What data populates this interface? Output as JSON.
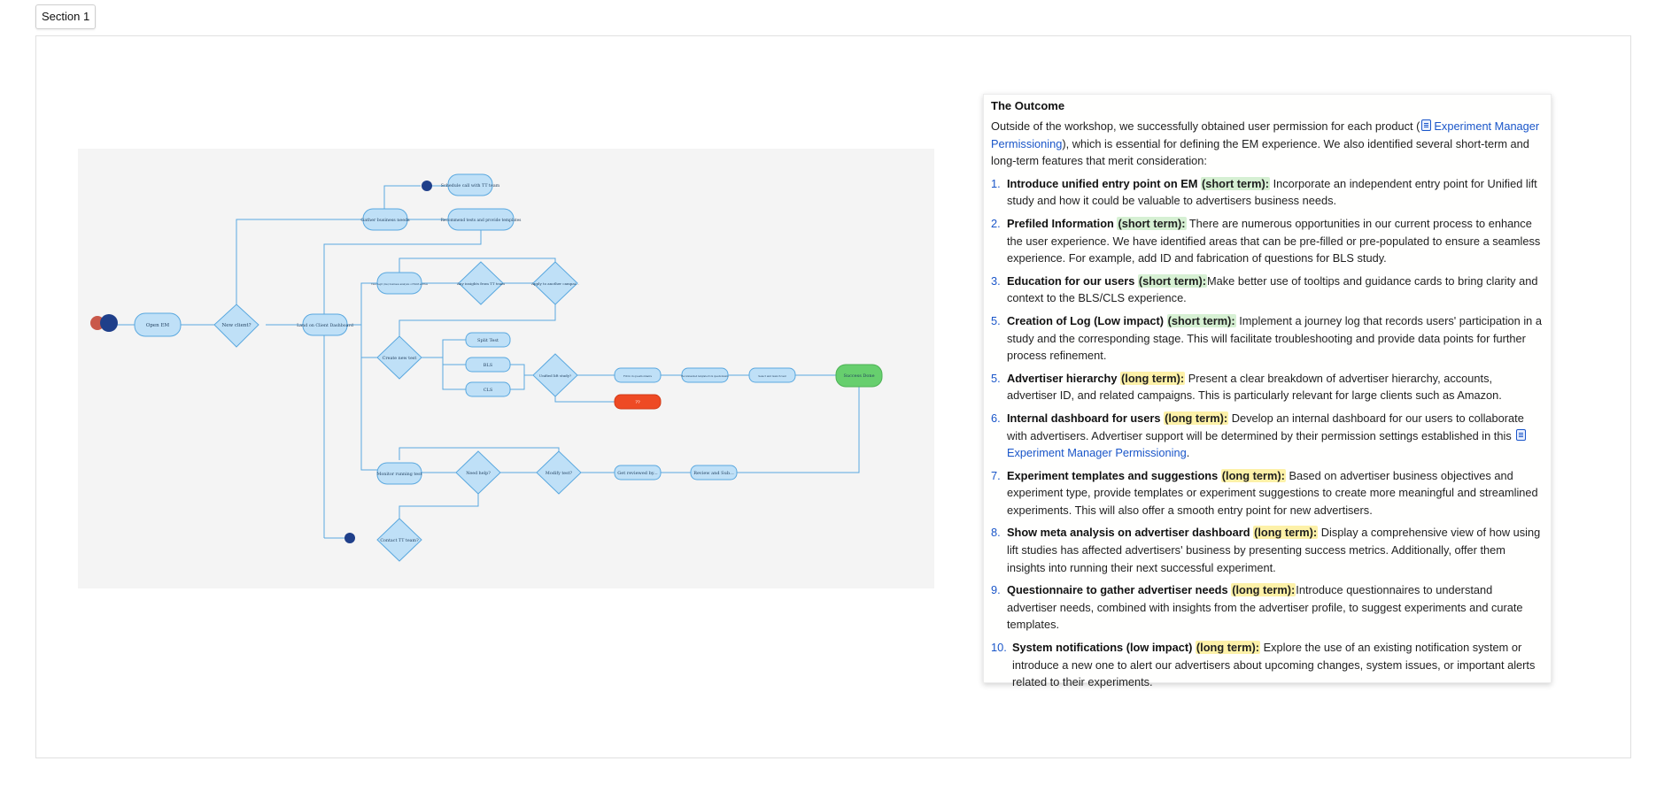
{
  "section": {
    "label": "Section 1"
  },
  "flow": {
    "nodes": {
      "open_em": "Open EM",
      "new_client": "New client?",
      "land_dashboard": "Land on Client Dashboard",
      "gather_needs": "Gather business needs",
      "schedule_call": "Schedule call with TT team",
      "recommend_tests": "Recommend tests and provide templates",
      "view_legit": "View legit (ms) business analysis of RAM entries",
      "any_insights": "Any insights from TT team",
      "apply_another": "Apply to another campai...",
      "create_test": "Create new test",
      "split_test": "Split Test",
      "bls": "BLS",
      "cls": "CLS",
      "unified_lift": "Unified lift study?",
      "fill_questionnaire": "Fill in in questionnaire",
      "recommend_template": "Recommended template from questionnaire",
      "select_campaign": "Select and launch test",
      "unknown": "??",
      "success": "Success Done",
      "monitor": "Monitor running test",
      "need_help": "Need help?",
      "modify_test": "Modify test?",
      "get_reviewed": "Get reviewed by...",
      "review_submit": "Review and Sub...",
      "contact_team": "Contact TT team?"
    }
  },
  "outcome": {
    "title": "The Outcome",
    "intro_before": "Outside of the workshop, we successfully obtained user permission for each product (",
    "intro_link": "Experiment Manager Permissioning",
    "intro_after": "), which is essential for defining the EM experience. We also identified several short-term and long-term features that merit consideration:",
    "items": [
      {
        "num": "1.",
        "title": "Introduce unified entry point on EM",
        "tag": "(short term):",
        "text": "Incorporate an independent entry point for Unified lift study and how it could be valuable to advertisers business needs."
      },
      {
        "num": "2.",
        "title": "Prefiled Information",
        "tag": "(short term):",
        "text": "There are numerous opportunities in our current process to enhance the user experience. We have identified areas that can be pre-filled or pre-populated to ensure a seamless experience. For example, add ID and fabrication of questions for BLS study."
      },
      {
        "num": "3.",
        "title": "Education for our users",
        "tag": "(short term):",
        "text": "Make better use of tooltips and guidance cards to bring clarity and context to the BLS/CLS experience."
      },
      {
        "num": "5.",
        "title": "Creation of Log (Low impact)",
        "tag": "(short term):",
        "text": "Implement a journey log that records users' participation in a study and the corresponding stage. This will facilitate troubleshooting and provide data points for further process refinement."
      },
      {
        "num": "5.",
        "title": "Advertiser hierarchy",
        "tag": "(long term):",
        "text": "Present a clear breakdown of advertiser hierarchy, accounts, advertiser ID, and related campaigns. This is particularly relevant for large clients such as Amazon."
      },
      {
        "num": "6.",
        "title": "Internal dashboard for users",
        "tag": "(long term):",
        "text": "Develop an internal dashboard for our users to collaborate with advertisers. Advertiser support will be determined by their permission settings established in this",
        "link": "Experiment Manager Permissioning",
        "after": "."
      },
      {
        "num": "7.",
        "title": "Experiment templates and suggestions",
        "tag": "(long term):",
        "text": "Based on advertiser business objectives and experiment type, provide templates or experiment suggestions to create more meaningful and streamlined experiments. This will also offer a smooth entry point for new advertisers."
      },
      {
        "num": "8.",
        "title": "Show meta analysis on advertiser dashboard",
        "tag": "(long term):",
        "text": "Display a comprehensive view of how using lift studies has affected advertisers' business by presenting success metrics. Additionally, offer them insights into running their next successful experiment."
      },
      {
        "num": "9.",
        "title": "Questionnaire to gather advertiser needs",
        "tag": "(long term):",
        "text": "Introduce questionnaires to understand advertiser needs, combined with insights from the advertiser profile, to suggest experiments and curate templates."
      },
      {
        "num": "10.",
        "title": "System notifications (low impact)",
        "tag": "(long term):",
        "text": "Explore the use of an existing notification system or introduce a new one to alert our advertisers about upcoming changes, system issues, or important alerts related to their experiments."
      }
    ]
  }
}
